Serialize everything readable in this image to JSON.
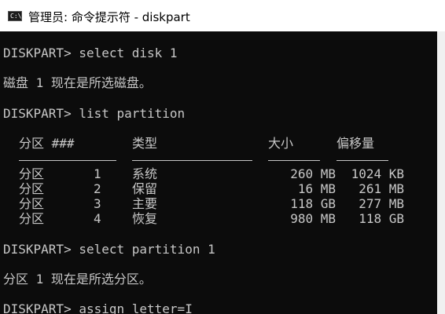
{
  "window": {
    "icon_text": "C:\\",
    "title": "管理员: 命令提示符 - diskpart"
  },
  "console": {
    "cmd1": "DISKPART> select disk 1",
    "out1": "磁盘 1 现在是所选磁盘。",
    "cmd2": "DISKPART> list partition",
    "table": {
      "headers": [
        "分区 ###",
        "类型",
        "大小",
        "偏移量"
      ],
      "rows": [
        {
          "name": "分区",
          "num": "1",
          "type": "系统",
          "size": "260 MB",
          "offset": "1024 KB"
        },
        {
          "name": "分区",
          "num": "2",
          "type": "保留",
          "size": "16 MB",
          "offset": "261 MB"
        },
        {
          "name": "分区",
          "num": "3",
          "type": "主要",
          "size": "118 GB",
          "offset": "277 MB"
        },
        {
          "name": "分区",
          "num": "4",
          "type": "恢复",
          "size": "980 MB",
          "offset": "118 GB"
        }
      ]
    },
    "cmd3": "DISKPART> select partition 1",
    "out3": "分区 1 现在是所选分区。",
    "cmd4": "DISKPART> assign letter=I"
  }
}
